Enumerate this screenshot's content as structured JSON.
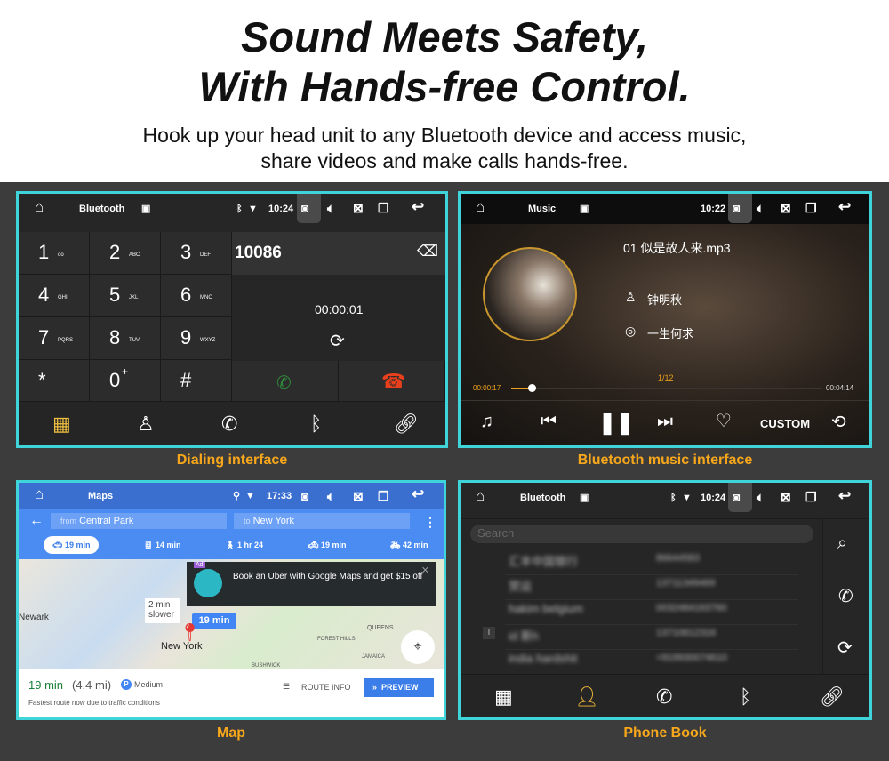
{
  "hero": {
    "title_line1": "Sound Meets Safety,",
    "title_line2": "With Hands-free Control.",
    "subtitle_line1": "Hook up your head unit to any Bluetooth device and access music,",
    "subtitle_line2": "share videos and make calls hands-free."
  },
  "colors": {
    "panel_border": "#3fd4d9",
    "caption": "#f7a71b",
    "accent_orange": "#f0a21c",
    "call_green": "#2e8b3a",
    "hangup_red": "#e8401c",
    "maps_blue": "#4285f4"
  },
  "dialer": {
    "caption": "Dialing interface",
    "app": "Bluetooth",
    "time": "10:24",
    "number": "10086",
    "duration": "00:00:01",
    "keys": [
      {
        "d": "1",
        "l": "oo"
      },
      {
        "d": "2",
        "l": "ABC"
      },
      {
        "d": "3",
        "l": "DEF"
      },
      {
        "d": "4",
        "l": "GHI"
      },
      {
        "d": "5",
        "l": "JKL"
      },
      {
        "d": "6",
        "l": "MNO"
      },
      {
        "d": "7",
        "l": "PQRS"
      },
      {
        "d": "8",
        "l": "TUV"
      },
      {
        "d": "9",
        "l": "WXYZ"
      },
      {
        "d": "*",
        "l": ""
      },
      {
        "d": "0",
        "l": "+"
      },
      {
        "d": "#",
        "l": ""
      }
    ]
  },
  "music": {
    "caption": "Bluetooth music interface",
    "app": "Music",
    "time": "10:22",
    "track": "01 似是故人来.mp3",
    "artist": "钟明秋",
    "album": "一生何求",
    "counter": "1/12",
    "elapsed": "00:00:17",
    "total": "00:04:14",
    "progress": 0.067,
    "custom": "CUSTOM"
  },
  "maps": {
    "caption": "Map",
    "app": "Maps",
    "time": "17:33",
    "from_label": "from",
    "from": "Central Park",
    "to_label": "to",
    "to": "New York",
    "modes": [
      {
        "icon": "car-icon",
        "text": "19 min"
      },
      {
        "icon": "train-icon",
        "text": "14 min"
      },
      {
        "icon": "walk-icon",
        "text": "1 hr 24"
      },
      {
        "icon": "rideshare-icon",
        "text": "19 min"
      },
      {
        "icon": "bike-icon",
        "text": "42 min"
      }
    ],
    "ad_badge": "Ad",
    "ad_text": "Book an Uber with Google Maps and get $15 off",
    "slower": "2 min slower",
    "route_time": "19 min",
    "place_newark": "Newark",
    "place_ny": "New York",
    "place_queens": "QUEENS",
    "place_forest": "FOREST HILLS",
    "place_jamaica": "JAMAICA",
    "place_bushwick": "BUSHWICK",
    "summary_time": "19 min",
    "summary_dist": "(4.4 mi)",
    "parking": "Medium",
    "parking_badge": "P",
    "note": "Fastest route now due to traffic conditions",
    "route_info": "ROUTE INFO",
    "preview": "PREVIEW"
  },
  "phonebook": {
    "caption": "Phone Book",
    "app": "Bluetooth",
    "time": "10:24",
    "search_placeholder": "Search",
    "index_letter": "I",
    "contacts": [
      {
        "name": "汇丰中国银行",
        "num": "86644583"
      },
      {
        "name": "贺运",
        "num": "13711349469"
      },
      {
        "name": "hakim belgium",
        "num": "0032484163760"
      },
      {
        "name": "id 斯h",
        "num": "13710612316"
      },
      {
        "name": "india hardshit",
        "num": "+919930074610"
      }
    ]
  }
}
